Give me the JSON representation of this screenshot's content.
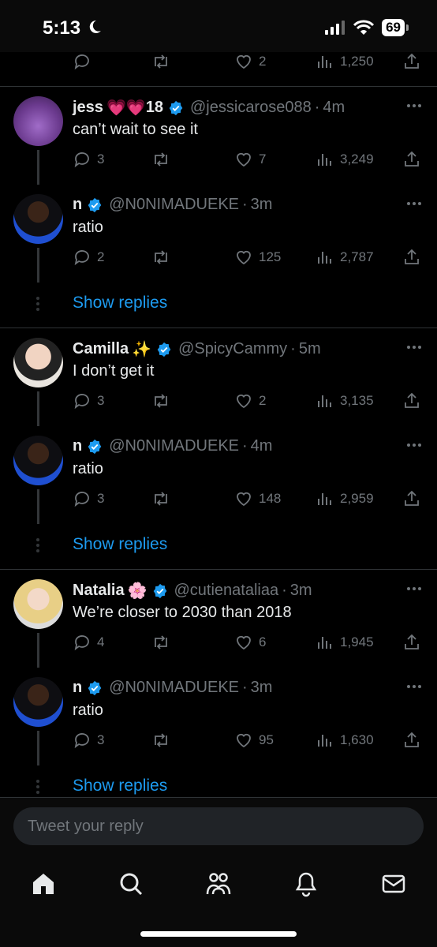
{
  "status_bar": {
    "time": "5:13",
    "battery": "69"
  },
  "top_actions": {
    "likes": "2",
    "views": "1,250"
  },
  "threads": [
    {
      "parent": {
        "name": "jess",
        "emoji": "💗💗",
        "name_suffix": "18",
        "handle": "@jessicarose088",
        "time": "4m",
        "text": "can’t wait to see it",
        "replies": "3",
        "likes": "7",
        "views": "3,249"
      },
      "reply": {
        "name": "n",
        "handle": "@N0NIMADUEKE",
        "time": "3m",
        "text": "ratio",
        "replies": "2",
        "likes": "125",
        "views": "2,787"
      },
      "show_replies": "Show replies"
    },
    {
      "parent": {
        "name": "Camilla",
        "emoji": "✨",
        "name_suffix": "",
        "handle": "@SpicyCammy",
        "time": "5m",
        "text": "I don’t get it",
        "replies": "3",
        "likes": "2",
        "views": "3,135"
      },
      "reply": {
        "name": "n",
        "handle": "@N0NIMADUEKE",
        "time": "4m",
        "text": "ratio",
        "replies": "3",
        "likes": "148",
        "views": "2,959"
      },
      "show_replies": "Show replies"
    },
    {
      "parent": {
        "name": "Natalia",
        "emoji": "🌸",
        "name_suffix": "",
        "handle": "@cutienataliaa",
        "time": "3m",
        "text": "We’re closer to 2030 than 2018",
        "replies": "4",
        "likes": "6",
        "views": "1,945"
      },
      "reply": {
        "name": "n",
        "handle": "@N0NIMADUEKE",
        "time": "3m",
        "text": "ratio",
        "replies": "3",
        "likes": "95",
        "views": "1,630"
      },
      "show_replies": "Show replies"
    }
  ],
  "composer": {
    "placeholder": "Tweet your reply"
  },
  "tabbar": [
    "home-icon",
    "search-icon",
    "communities-icon",
    "notifications-icon",
    "messages-icon"
  ],
  "colors": {
    "accent": "#1d9bf0",
    "muted": "#71767b",
    "verified": "#1d9bf0"
  }
}
